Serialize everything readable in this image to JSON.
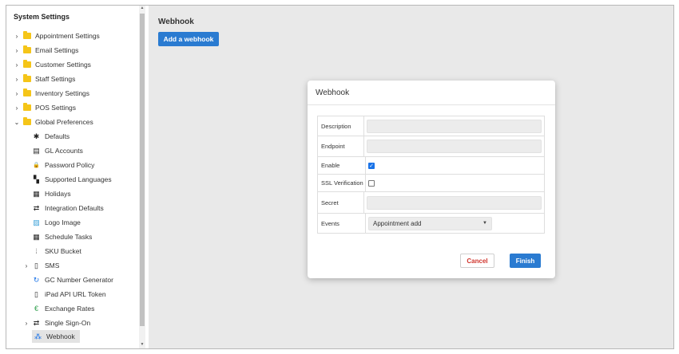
{
  "sidebar": {
    "title": "System Settings",
    "folders": [
      {
        "label": "Appointment Settings",
        "caret": "›"
      },
      {
        "label": "Email Settings",
        "caret": "›"
      },
      {
        "label": "Customer Settings",
        "caret": "›"
      },
      {
        "label": "Staff Settings",
        "caret": "›"
      },
      {
        "label": "Inventory Settings",
        "caret": "›"
      },
      {
        "label": "POS Settings",
        "caret": "›"
      },
      {
        "label": "Global Preferences",
        "caret": "⌄"
      }
    ],
    "children": [
      {
        "label": "Defaults",
        "icon": "gear-icon",
        "glyph": "✱"
      },
      {
        "label": "GL Accounts",
        "icon": "gl-accounts-icon",
        "glyph": "▤"
      },
      {
        "label": "Password Policy",
        "icon": "lock-icon",
        "glyph": "🔒"
      },
      {
        "label": "Supported Languages",
        "icon": "language-icon",
        "glyph": "▚"
      },
      {
        "label": "Holidays",
        "icon": "calendar-icon",
        "glyph": "▦"
      },
      {
        "label": "Integration Defaults",
        "icon": "sync-icon",
        "glyph": "⇄"
      },
      {
        "label": "Logo Image",
        "icon": "image-icon",
        "glyph": "▨"
      },
      {
        "label": "Schedule Tasks",
        "icon": "schedule-icon",
        "glyph": "▦"
      },
      {
        "label": "SKU Bucket",
        "icon": "barcode-icon",
        "glyph": "⦙"
      },
      {
        "label": "SMS",
        "icon": "sms-icon",
        "glyph": "▯",
        "caret": "›"
      },
      {
        "label": "GC Number Generator",
        "icon": "generator-icon",
        "glyph": "↻"
      },
      {
        "label": "iPad API URL Token",
        "icon": "tablet-icon",
        "glyph": "▯"
      },
      {
        "label": "Exchange Rates",
        "icon": "currency-icon",
        "glyph": "€"
      },
      {
        "label": "Single Sign-On",
        "icon": "sso-icon",
        "glyph": "⇄",
        "caret": "›"
      },
      {
        "label": "Webhook",
        "icon": "webhook-icon",
        "glyph": "⁂"
      }
    ]
  },
  "main": {
    "title": "Webhook",
    "add_button": "Add a webhook"
  },
  "modal": {
    "title": "Webhook",
    "fields": {
      "description": {
        "label": "Description",
        "value": ""
      },
      "endpoint": {
        "label": "Endpoint",
        "value": ""
      },
      "enable": {
        "label": "Enable",
        "checked": true
      },
      "ssl": {
        "label": "SSL Verification",
        "checked": false
      },
      "secret": {
        "label": "Secret",
        "value": ""
      },
      "events": {
        "label": "Events",
        "value": "Appointment add"
      }
    },
    "cancel": "Cancel",
    "finish": "Finish"
  },
  "colors": {
    "primary": "#2a7bd1",
    "cancel_text": "#d0342c",
    "folder": "#f5c518",
    "main_bg": "#e9e9e9"
  }
}
